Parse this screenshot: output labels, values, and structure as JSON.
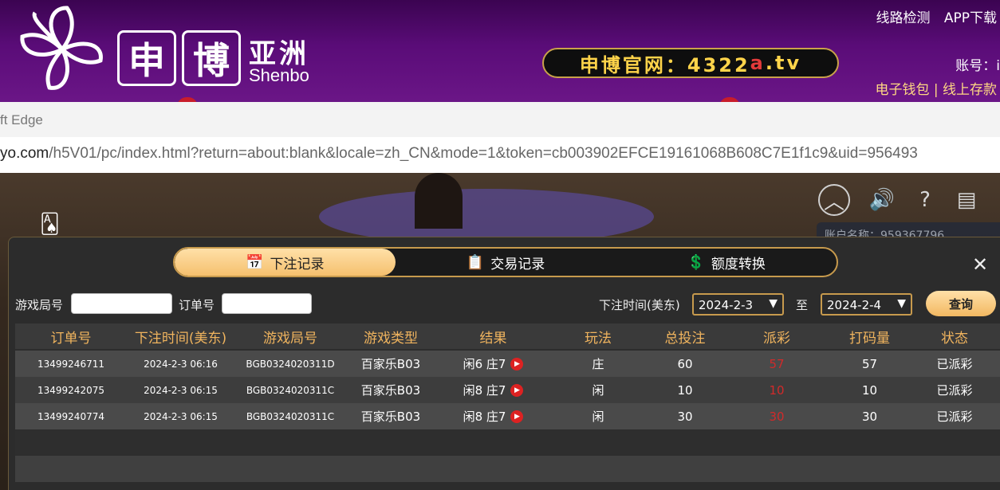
{
  "header": {
    "logo_char1": "申",
    "logo_char2": "博",
    "logo_cn": "亚洲",
    "logo_en": "Shenbo",
    "site_prefix": "申博官网：4322",
    "site_red": "a",
    "site_suffix": ".tv",
    "link_line_check": "线路检测",
    "link_app": "APP下载",
    "account_label": "账号：i",
    "wallet_label": "电子钱包",
    "wallet_sep": "|",
    "deposit_label": "线上存款"
  },
  "browser": {
    "title": "ft Edge",
    "url_host": "yo.com",
    "url_path": "/h5V01/pc/index.html?return=about:blank&locale=zh_CN&mode=1&token=cb003902EFCE19161068B608C7E1f1c9&uid=956493"
  },
  "game": {
    "account_name": "账户名称：959367796"
  },
  "modal": {
    "tabs": [
      {
        "label": "下注记录",
        "icon": "calendar-icon",
        "active": true
      },
      {
        "label": "交易记录",
        "icon": "clipboard-icon",
        "active": false
      },
      {
        "label": "额度转换",
        "icon": "coins-icon",
        "active": false
      }
    ],
    "filters": {
      "round_label": "游戏局号",
      "order_label": "订单号",
      "time_label": "下注时间(美东)",
      "date_from": "2024-2-3",
      "to_label": "至",
      "date_to": "2024-2-4",
      "query_label": "查询"
    },
    "columns": [
      "订单号",
      "下注时间(美东)",
      "游戏局号",
      "游戏类型",
      "结果",
      "玩法",
      "总投注",
      "派彩",
      "打码量",
      "状态"
    ],
    "rows": [
      {
        "order": "13499246711",
        "time": "2024-2-3 06:16",
        "round": "BGB0324020311D",
        "type": "百家乐B03",
        "result": "闲6 庄7",
        "play": "庄",
        "bet": "60",
        "payout": "57",
        "turnover": "57",
        "status": "已派彩"
      },
      {
        "order": "13499242075",
        "time": "2024-2-3 06:15",
        "round": "BGB0324020311C",
        "type": "百家乐B03",
        "result": "闲8 庄7",
        "play": "闲",
        "bet": "10",
        "payout": "10",
        "turnover": "10",
        "status": "已派彩"
      },
      {
        "order": "13499240774",
        "time": "2024-2-3 06:15",
        "round": "BGB0324020311C",
        "type": "百家乐B03",
        "result": "闲8 庄7",
        "play": "闲",
        "bet": "30",
        "payout": "30",
        "turnover": "30",
        "status": "已派彩"
      }
    ]
  }
}
